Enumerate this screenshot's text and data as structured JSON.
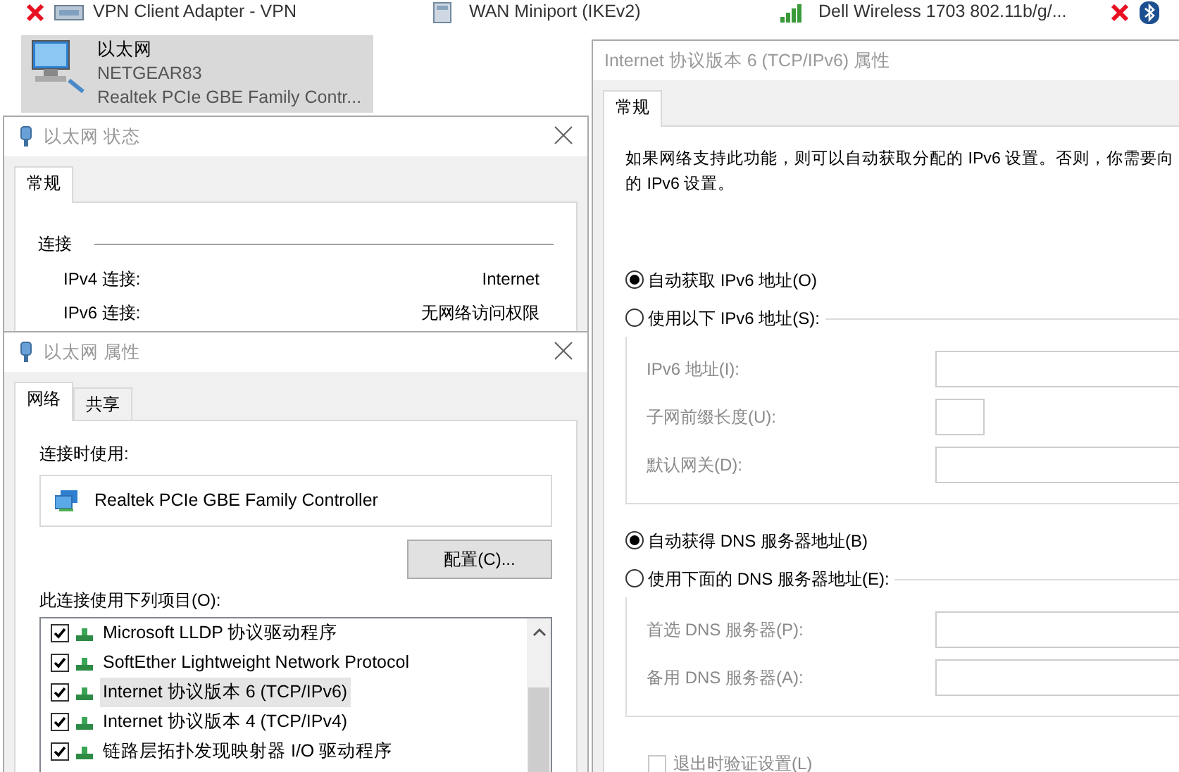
{
  "adapters": [
    {
      "kind": "vpn",
      "name": "VPN Client Adapter - VPN",
      "disconnected": true
    },
    {
      "kind": "wan",
      "name": "WAN Miniport (IKEv2)",
      "disconnected": false
    },
    {
      "kind": "wireless",
      "name": "Dell Wireless 1703 802.11b/g/...",
      "disconnected": false
    },
    {
      "kind": "bluetooth",
      "disconnected": true
    }
  ],
  "current_adapter": {
    "name": "以太网",
    "network": "NETGEAR83",
    "device": "Realtek PCIe GBE Family Contr...",
    "selected": true
  },
  "status_window": {
    "title": "以太网 状态",
    "tabs": [
      {
        "label": "常规",
        "selected": true
      }
    ],
    "section": "连接",
    "rows": [
      {
        "label": "IPv4 连接:",
        "value": "Internet"
      },
      {
        "label": "IPv6 连接:",
        "value": "无网络访问权限"
      }
    ]
  },
  "properties_window": {
    "title": "以太网 属性",
    "tabs": [
      {
        "label": "网络",
        "selected": true
      },
      {
        "label": "共享",
        "selected": false
      }
    ],
    "connect_using_label": "连接时使用:",
    "adapter": "Realtek PCIe GBE Family Controller",
    "configure_button": "配置(C)...",
    "items_label": "此连接使用下列项目(O):",
    "items": [
      {
        "label": "Microsoft LLDP 协议驱动程序",
        "checked": true,
        "selected": false
      },
      {
        "label": "SoftEther Lightweight Network Protocol",
        "checked": true,
        "selected": false
      },
      {
        "label": "Internet 协议版本 6 (TCP/IPv6)",
        "checked": true,
        "selected": true
      },
      {
        "label": "Internet 协议版本 4 (TCP/IPv4)",
        "checked": true,
        "selected": false
      },
      {
        "label": "链路层拓扑发现映射器 I/O 驱动程序",
        "checked": true,
        "selected": false
      }
    ]
  },
  "ipv6_window": {
    "title": "Internet 协议版本 6 (TCP/IPv6) 属性",
    "tabs": [
      {
        "label": "常规",
        "selected": true
      }
    ],
    "description_lines": [
      "如果网络支持此功能，则可以自动获取分配的 IPv6 设置。否则，你需要向",
      "的 IPv6 设置。"
    ],
    "address_options": [
      {
        "label": "自动获取 IPv6 地址(O)",
        "selected": true
      },
      {
        "label": "使用以下 IPv6 地址(S):",
        "selected": false
      }
    ],
    "address_fields": [
      {
        "label": "IPv6 地址(I):",
        "kind": "wide",
        "disabled": true
      },
      {
        "label": "子网前缀长度(U):",
        "kind": "short",
        "disabled": true
      },
      {
        "label": "默认网关(D):",
        "kind": "wide",
        "disabled": true
      }
    ],
    "dns_options": [
      {
        "label": "自动获得 DNS 服务器地址(B)",
        "selected": true
      },
      {
        "label": "使用下面的 DNS 服务器地址(E):",
        "selected": false
      }
    ],
    "dns_fields": [
      {
        "label": "首选 DNS 服务器(P):",
        "kind": "wide",
        "disabled": true
      },
      {
        "label": "备用 DNS 服务器(A):",
        "kind": "wide",
        "disabled": true
      }
    ],
    "validate_checkbox": {
      "label": "退出时验证设置(L)",
      "checked": false,
      "disabled": true
    }
  }
}
